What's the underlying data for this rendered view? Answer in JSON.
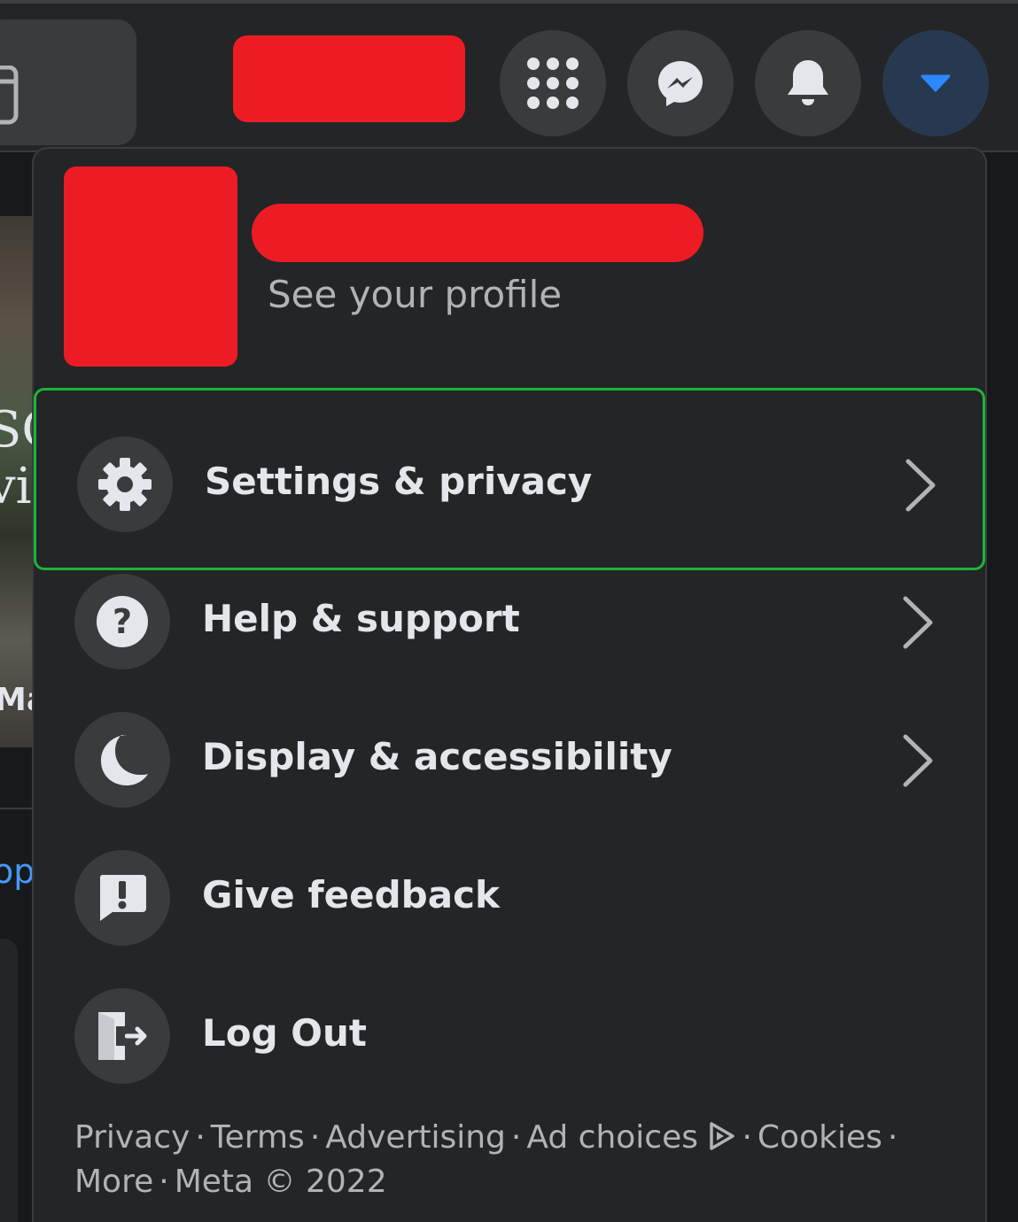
{
  "header": {
    "buttons": [
      {
        "name": "menu",
        "icon": "grid-icon"
      },
      {
        "name": "messenger",
        "icon": "messenger-icon"
      },
      {
        "name": "notifications",
        "icon": "bell-icon"
      },
      {
        "name": "account",
        "icon": "caret-down-icon"
      }
    ]
  },
  "background": {
    "photo_text": "SC\nvi",
    "caption": "Ma",
    "link_text": "op"
  },
  "account_menu": {
    "profile": {
      "subtitle": "See your profile"
    },
    "items": [
      {
        "label": "Settings & privacy",
        "icon": "gear-icon",
        "has_submenu": true,
        "highlighted": true
      },
      {
        "label": "Help & support",
        "icon": "question-icon",
        "has_submenu": true
      },
      {
        "label": "Display & accessibility",
        "icon": "moon-icon",
        "has_submenu": true
      },
      {
        "label": "Give feedback",
        "icon": "feedback-icon",
        "has_submenu": false
      },
      {
        "label": "Log Out",
        "icon": "logout-icon",
        "has_submenu": false
      }
    ],
    "footer": {
      "links": [
        "Privacy",
        "Terms",
        "Advertising",
        "Ad choices",
        "Cookies",
        "More"
      ],
      "separator": "·",
      "copyright": "Meta © 2022"
    }
  },
  "colors": {
    "panel_bg": "#242526",
    "page_bg": "#18191a",
    "icon_circle": "#3a3b3c",
    "text_primary": "#e4e6eb",
    "text_secondary": "#b0b3b8",
    "highlight_border": "#1db43a",
    "accent": "#2d88ff",
    "redaction": "#ed1c24"
  }
}
